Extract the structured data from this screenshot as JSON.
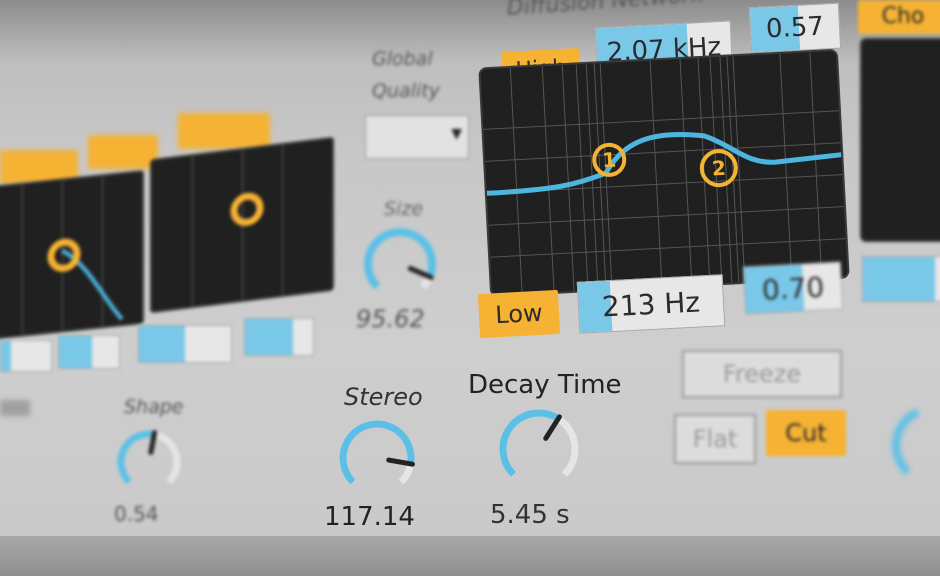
{
  "colors": {
    "accent_orange": "#f5b233",
    "accent_blue": "#5cc0e6",
    "screen_bg": "#202020",
    "curve": "#4db6e0"
  },
  "diffusion": {
    "title": "Diffusion Network",
    "high_button": "High",
    "low_button": "Low",
    "high_freq": "2.07 kHz",
    "high_value": "0.57",
    "low_freq": "213 Hz",
    "low_value": "0.70",
    "node_1": "1",
    "node_2": "2"
  },
  "global": {
    "label_line1": "Global",
    "label_line2": "Quality"
  },
  "size": {
    "label": "Size",
    "value": "95.62",
    "level": 0.92
  },
  "stereo": {
    "label": "Stereo",
    "value": "117.14",
    "level": 0.87
  },
  "decay": {
    "label": "Decay Time",
    "value": "5.45 s",
    "level": 0.62
  },
  "shape": {
    "label": "Shape",
    "value": "0.54",
    "level": 0.54
  },
  "freeze": {
    "freeze_button": "Freeze",
    "flat_button": "Flat",
    "cut_button": "Cut"
  },
  "chorus": {
    "button": "Cho"
  }
}
